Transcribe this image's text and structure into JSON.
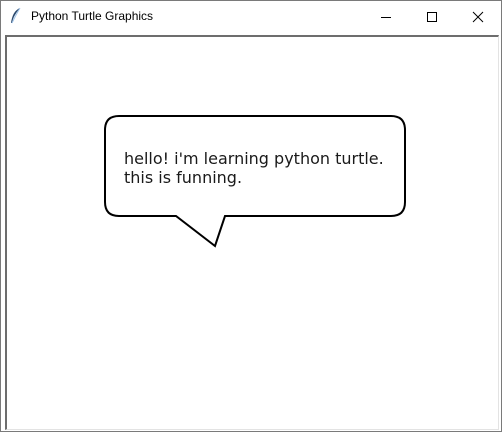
{
  "window": {
    "title": "Python Turtle Graphics",
    "icon": "feather-icon",
    "controls": {
      "minimize_icon": "minimize-icon",
      "maximize_icon": "maximize-icon",
      "close_icon": "close-icon"
    }
  },
  "canvas": {
    "speech_bubble": {
      "lines": [
        "hello! i'm learning python turtle.",
        "this is funning."
      ]
    }
  }
}
